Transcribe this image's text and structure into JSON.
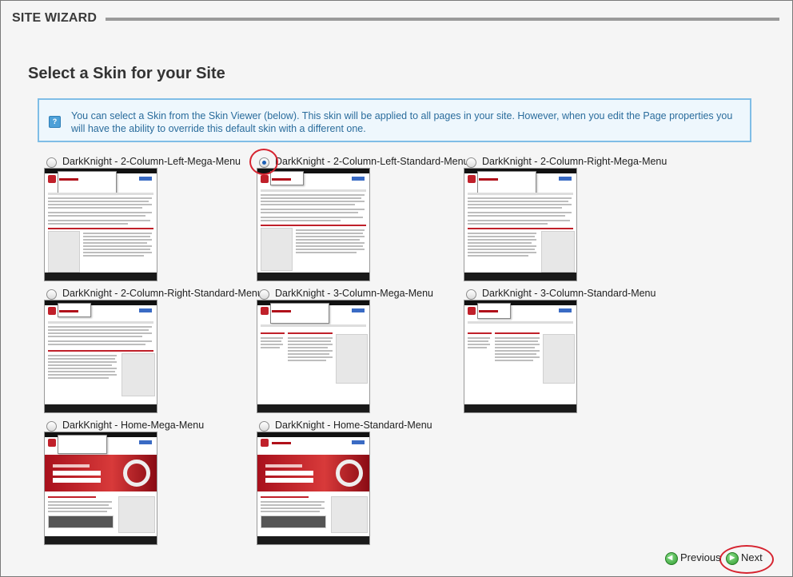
{
  "header": {
    "title": "SITE WIZARD"
  },
  "page": {
    "title": "Select a Skin for your Site"
  },
  "info": {
    "icon": "info-icon",
    "text": "You can select a Skin from the Skin Viewer (below). This skin will be applied to all pages in your site. However, when you edit the Page properties you will have the ability to override this default skin with a different one."
  },
  "skins": [
    {
      "label": "DarkKnight - 2-Column-Left-Mega-Menu",
      "selected": false
    },
    {
      "label": "DarkKnight - 2-Column-Left-Standard-Menu",
      "selected": true
    },
    {
      "label": "DarkKnight - 2-Column-Right-Mega-Menu",
      "selected": false
    },
    {
      "label": "DarkKnight - 2-Column-Right-Standard-Menu",
      "selected": false
    },
    {
      "label": "DarkKnight - 3-Column-Mega-Menu",
      "selected": false
    },
    {
      "label": "DarkKnight - 3-Column-Standard-Menu",
      "selected": false
    },
    {
      "label": "DarkKnight - Home-Mega-Menu",
      "selected": false
    },
    {
      "label": "DarkKnight - Home-Standard-Menu",
      "selected": false
    }
  ],
  "footer": {
    "previous_label": "Previous",
    "next_label": "Next"
  },
  "colors": {
    "annotation": "#d62430",
    "info_border": "#7fbde6",
    "info_text": "#2a6c9c",
    "nav_icon": "#2e9a2e"
  }
}
